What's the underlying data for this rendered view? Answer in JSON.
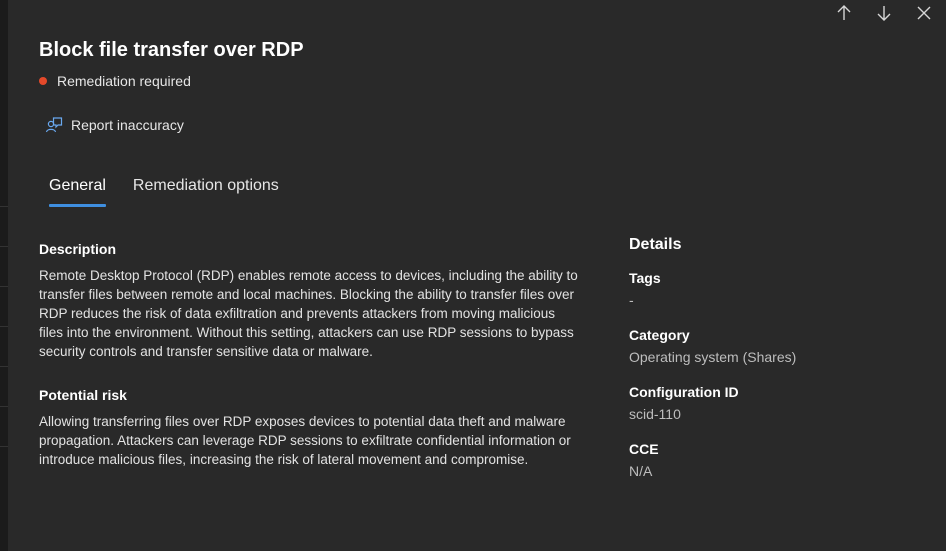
{
  "title": "Block file transfer over RDP",
  "status": {
    "label": "Remediation required",
    "color": "#e4492a"
  },
  "report": {
    "label": "Report inaccuracy",
    "icon": "report-person-icon"
  },
  "tabs": [
    {
      "label": "General",
      "active": true
    },
    {
      "label": "Remediation options",
      "active": false
    }
  ],
  "description": {
    "heading": "Description",
    "lines": [
      "Remote Desktop Protocol (RDP) enables remote access to devices, including the ability to",
      "transfer files between remote and local machines. Blocking the ability to transfer files over",
      "RDP reduces the risk of data exfiltration and prevents attackers from moving malicious",
      "files into the environment. Without this setting, attackers can use RDP sessions to bypass",
      "security controls and transfer sensitive data or malware."
    ]
  },
  "risk": {
    "heading": "Potential risk",
    "lines": [
      "Allowing transferring files over RDP exposes devices to potential data theft and malware",
      "propagation. Attackers can leverage RDP sessions to exfiltrate confidential information or",
      "introduce malicious files, increasing the risk of lateral movement and compromise."
    ]
  },
  "details": {
    "title": "Details",
    "tags": {
      "label": "Tags",
      "value": "-"
    },
    "category": {
      "label": "Category",
      "value": "Operating system (Shares)"
    },
    "config_id": {
      "label": "Configuration ID",
      "value": "scid-110"
    },
    "cce": {
      "label": "CCE",
      "value": "N/A"
    }
  },
  "icons": {
    "previous": "arrow-up-icon",
    "next": "arrow-down-icon",
    "close": "close-icon"
  },
  "colors": {
    "accent": "#3f8fe0",
    "background": "#292929"
  }
}
